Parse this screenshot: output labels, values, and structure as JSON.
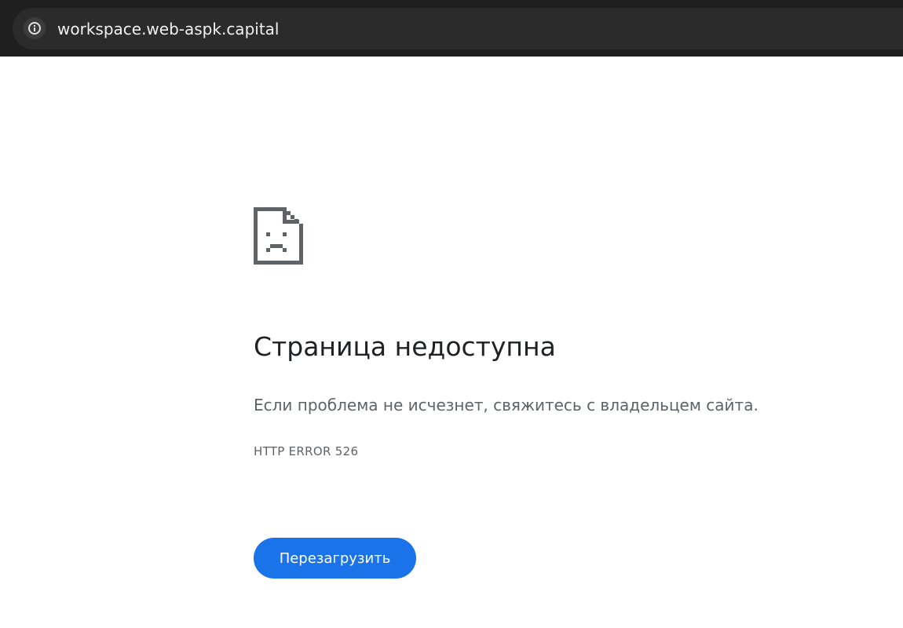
{
  "browser": {
    "url": "workspace.web-aspk.capital",
    "site_info_icon": "info-icon"
  },
  "error": {
    "icon": "sad-page-icon",
    "title": "Страница недоступна",
    "message": "Если проблема не исчезнет, свяжитесь с владельцем сайта.",
    "code": "HTTP ERROR 526",
    "reload_label": "Перезагрузить"
  },
  "colors": {
    "topbar": "#1f1f1f",
    "omnibox": "#2b2b2b",
    "accent": "#1a73e8",
    "title_text": "#202124",
    "secondary_text": "#5f6368"
  }
}
